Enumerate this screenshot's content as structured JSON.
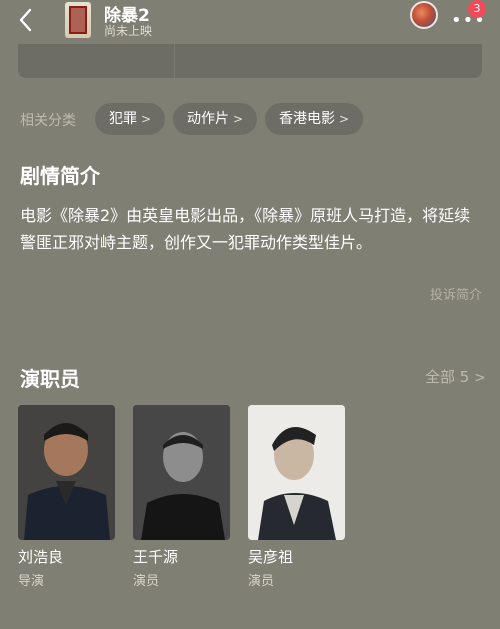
{
  "header": {
    "title": "除暴2",
    "subtitle": "尚未上映",
    "more": "•••",
    "badge_count": "3"
  },
  "related": {
    "label": "相关分类",
    "tags": [
      {
        "label": "犯罪"
      },
      {
        "label": "动作片"
      },
      {
        "label": "香港电影"
      }
    ]
  },
  "synopsis": {
    "heading": "剧情简介",
    "text": "电影《除暴2》由英皇电影出品，《除暴》原班人马打造，将延续警匪正邪对峙主题，创作又一犯罪动作类型佳片。",
    "report_link": "投诉简介"
  },
  "cast": {
    "heading": "演职员",
    "all_label": "全部 5",
    "members": [
      {
        "name": "刘浩良",
        "role": "导演"
      },
      {
        "name": "王千源",
        "role": "演员"
      },
      {
        "name": "吴彦祖",
        "role": "演员"
      }
    ]
  }
}
